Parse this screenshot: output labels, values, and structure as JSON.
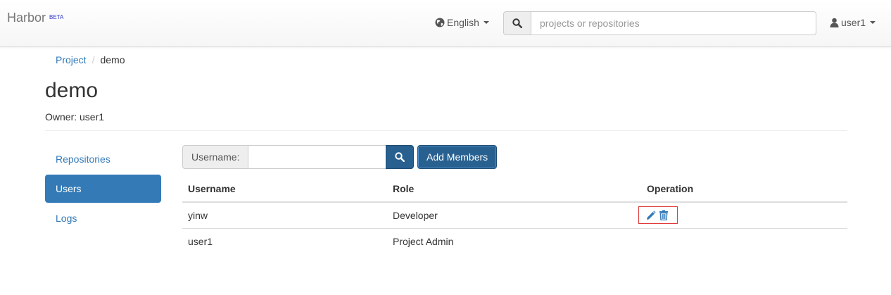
{
  "navbar": {
    "brand": "Harbor",
    "brand_badge": "BETA",
    "language": "English",
    "search_placeholder": "projects or repositories",
    "user": "user1"
  },
  "breadcrumb": {
    "root": "Project",
    "separator": "/",
    "current": "demo"
  },
  "project": {
    "title": "demo",
    "owner": "Owner: user1"
  },
  "sidenav": {
    "items": [
      {
        "label": "Repositories",
        "active": false
      },
      {
        "label": "Users",
        "active": true
      },
      {
        "label": "Logs",
        "active": false
      }
    ]
  },
  "members": {
    "search_label": "Username:",
    "search_value": "",
    "add_button": "Add Members",
    "columns": [
      "Username",
      "Role",
      "Operation"
    ],
    "rows": [
      {
        "username": "yinw",
        "role": "Developer",
        "operations": [
          "edit-icon",
          "trash-icon"
        ]
      },
      {
        "username": "user1",
        "role": "Project Admin",
        "operations": []
      }
    ]
  },
  "colors": {
    "primary": "#337ab7",
    "primary_dark": "#286090",
    "highlight_border": "#e03a3a"
  }
}
